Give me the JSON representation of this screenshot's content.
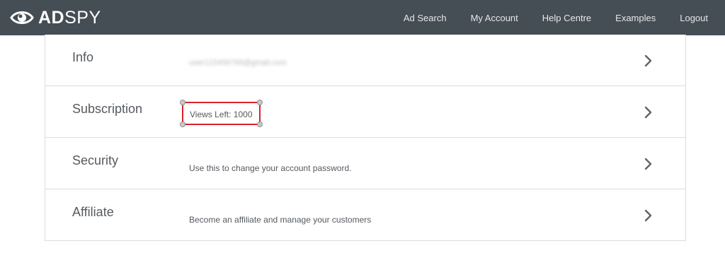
{
  "brand": {
    "name_bold": "AD",
    "name_light": "SPY",
    "logo_icon": "eye-icon"
  },
  "nav": {
    "items": [
      {
        "label": "Ad Search"
      },
      {
        "label": "My Account"
      },
      {
        "label": "Help Centre"
      },
      {
        "label": "Examples"
      },
      {
        "label": "Logout"
      }
    ]
  },
  "account": {
    "rows": [
      {
        "title": "Info",
        "description": "user123456789@gmail.com",
        "blurred": true
      },
      {
        "title": "Subscription",
        "description": "Views Left: 1000",
        "highlighted": true
      },
      {
        "title": "Security",
        "description": "Use this to change your account password."
      },
      {
        "title": "Affiliate",
        "description": "Become an affiliate and manage your customers"
      }
    ],
    "row_icon": "chevron-right-icon"
  },
  "colors": {
    "navbar_bg": "#454d55",
    "highlight": "#d9232d",
    "text": "#555a5f",
    "border": "#dcdcdc"
  }
}
